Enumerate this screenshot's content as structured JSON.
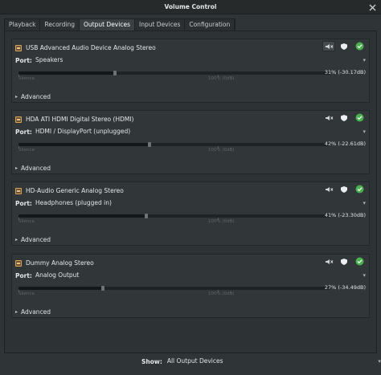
{
  "window": {
    "title": "Volume Control"
  },
  "tabs": [
    {
      "label": "Playback",
      "active": false
    },
    {
      "label": "Recording",
      "active": false
    },
    {
      "label": "Output Devices",
      "active": true
    },
    {
      "label": "Input Devices",
      "active": false
    },
    {
      "label": "Configuration",
      "active": false
    }
  ],
  "devices": [
    {
      "name": "USB Advanced Audio Device Analog Stereo",
      "port_label": "Port:",
      "port": "Speakers",
      "volume_text": "31% (-30.17dB)",
      "volume": 0.31,
      "silence": "Silence",
      "hundred": "100% (0dB)",
      "advanced": "Advanced"
    },
    {
      "name": "HDA ATI HDMI Digital Stereo (HDMI)",
      "port_label": "Port:",
      "port": "HDMI / DisplayPort (unplugged)",
      "volume_text": "42% (-22.61dB)",
      "volume": 0.42,
      "silence": "Silence",
      "hundred": "100% (0dB)",
      "advanced": "Advanced"
    },
    {
      "name": "HD-Audio Generic Analog Stereo",
      "port_label": "Port:",
      "port": "Headphones (plugged in)",
      "volume_text": "41% (-23.30dB)",
      "volume": 0.41,
      "silence": "Silence",
      "hundred": "100% (0dB)",
      "advanced": "Advanced"
    },
    {
      "name": "Dummy Analog Stereo",
      "port_label": "Port:",
      "port": "Analog Output",
      "volume_text": "27% (-34.49dB)",
      "volume": 0.27,
      "silence": "Silence",
      "hundred": "100% (0dB)",
      "advanced": "Advanced"
    }
  ],
  "footer": {
    "show_label": "Show:",
    "show_value": "All Output Devices"
  },
  "colors": {
    "default_green": "#4caf50",
    "accent": "#3a3f42"
  }
}
